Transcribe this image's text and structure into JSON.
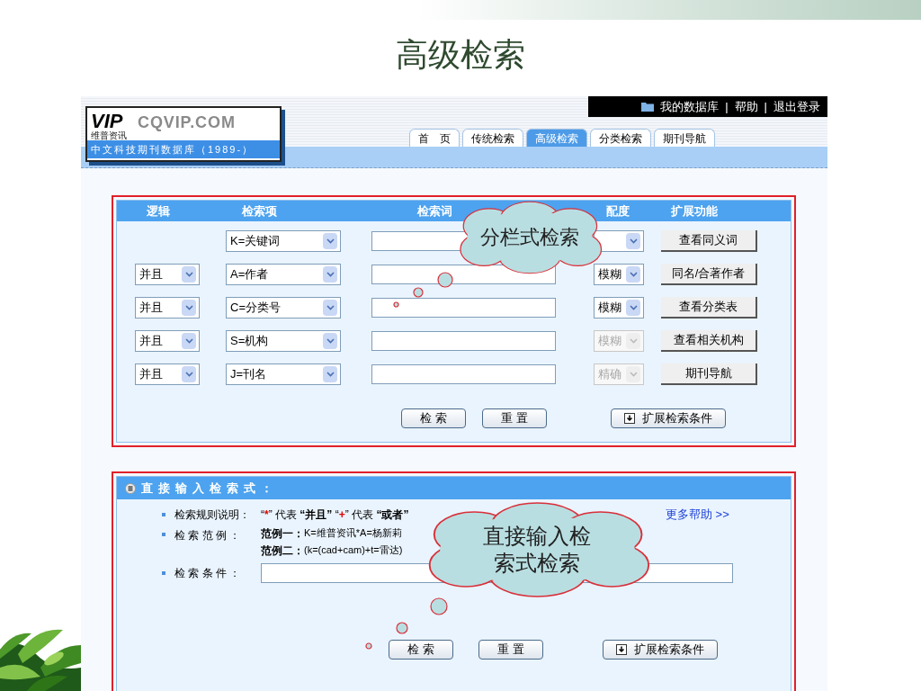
{
  "slide_title": "高级检索",
  "logo": {
    "mark": "VIP",
    "sub": "维普资讯",
    "domain": "CQVIP.COM",
    "caption": "中文科技期刊数据库（1989-）"
  },
  "top_links": [
    {
      "label": "我的数据库",
      "icon": true
    },
    {
      "label": "帮助",
      "icon": false
    },
    {
      "label": "退出登录",
      "icon": false
    }
  ],
  "link_separator": "|",
  "tabs": [
    {
      "label": "首　页",
      "selected": false
    },
    {
      "label": "传统检索",
      "selected": false
    },
    {
      "label": "高级检索",
      "selected": true
    },
    {
      "label": "分类检索",
      "selected": false
    },
    {
      "label": "期刊导航",
      "selected": false
    }
  ],
  "form": {
    "columns": [
      "逻辑",
      "检索项",
      "检索词",
      "配度",
      "扩展功能"
    ],
    "rows": [
      {
        "field": "K=关键词",
        "match": {
          "disabled": false
        },
        "action": "查看同义词"
      },
      {
        "logic": "并且",
        "field": "A=作者",
        "match": {
          "value": "模糊",
          "disabled": false
        },
        "action": "同名/合著作者"
      },
      {
        "logic": "并且",
        "field": "C=分类号",
        "match": {
          "value": "模糊",
          "disabled": false
        },
        "action": "查看分类表"
      },
      {
        "logic": "并且",
        "field": "S=机构",
        "match": {
          "value": "模糊",
          "disabled": true
        },
        "action": "查看相关机构"
      },
      {
        "logic": "并且",
        "field": "J=刊名",
        "match": {
          "value": "精确",
          "disabled": true
        },
        "action": "期刊导航"
      }
    ],
    "buttons": [
      "检 索",
      "重 置"
    ],
    "expand_button": "扩展检索条件"
  },
  "direct": {
    "title": "直接输入检索式：",
    "rule_label": "检索规则说明：",
    "rule": [
      {
        "text": "“",
        "kind": "plain"
      },
      {
        "text": "*",
        "kind": "operator"
      },
      {
        "text": "” 代表 ",
        "kind": "plain"
      },
      {
        "text": "“并且”",
        "kind": "term"
      },
      {
        "text": " “",
        "kind": "plain"
      },
      {
        "text": "+",
        "kind": "operator"
      },
      {
        "text": "” 代表 ",
        "kind": "plain"
      },
      {
        "text": "“或者”",
        "kind": "term"
      }
    ],
    "help_link": "更多帮助 >>",
    "example_label": "检 索 范 例 ：",
    "examples": [
      {
        "label": "范例一：",
        "text": "K=维普资讯*A=杨新莉"
      },
      {
        "label": "范例二：",
        "text": "(k=(cad+cam)+t=雷达)"
      }
    ],
    "condition_label": "检 索 条 件 ：",
    "buttons": [
      "检 索",
      "重 置"
    ],
    "expand_button": "扩展检索条件"
  },
  "callouts": [
    {
      "text": "分栏式检索"
    },
    {
      "text": "直接输入检索式检索"
    }
  ]
}
